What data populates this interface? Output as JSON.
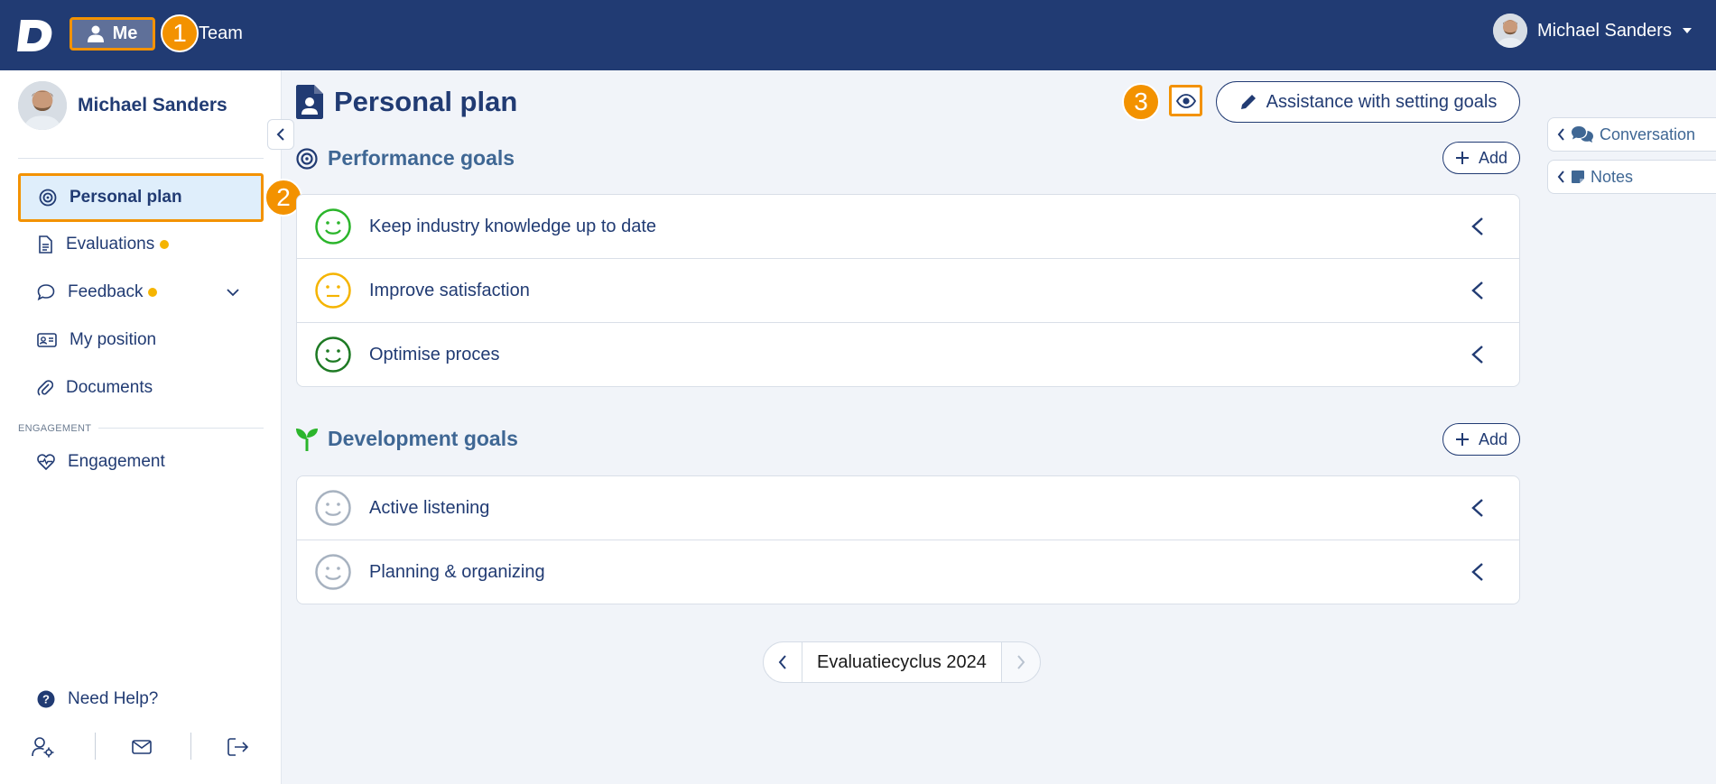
{
  "topbar": {
    "nav": {
      "me_label": "Me",
      "team_label": "Team"
    },
    "user_name": "Michael Sanders"
  },
  "badges": {
    "one": "1",
    "two": "2",
    "three": "3"
  },
  "sidebar": {
    "profile_name": "Michael Sanders",
    "items": [
      {
        "label": "Personal plan",
        "icon": "target-icon",
        "active": true
      },
      {
        "label": "Evaluations",
        "icon": "document-icon",
        "dot": true
      },
      {
        "label": "Feedback",
        "icon": "speech-bubble-icon",
        "dot": true,
        "expandable": true
      },
      {
        "label": "My position",
        "icon": "id-card-icon"
      },
      {
        "label": "Documents",
        "icon": "paperclip-icon"
      }
    ],
    "engagement_section_label": "ENGAGEMENT",
    "engagement_item": {
      "label": "Engagement",
      "icon": "heart-pulse-icon"
    },
    "help_label": "Need Help?"
  },
  "main": {
    "title": "Personal plan",
    "assist_button_label": "Assistance with setting goals",
    "performance": {
      "title": "Performance goals",
      "add_label": "Add",
      "goals": [
        {
          "label": "Keep industry knowledge up to date",
          "mood": "happy",
          "color": "#2bb52b"
        },
        {
          "label": "Improve satisfaction",
          "mood": "neutral",
          "color": "#f5b400"
        },
        {
          "label": "Optimise proces",
          "mood": "happy",
          "color": "#1e7a24"
        }
      ]
    },
    "development": {
      "title": "Development goals",
      "add_label": "Add",
      "goals": [
        {
          "label": "Active listening",
          "mood": "happy",
          "color": "#a7b2c0"
        },
        {
          "label": "Planning & organizing",
          "mood": "happy",
          "color": "#a7b2c0"
        }
      ]
    },
    "cycle_label": "Evaluatiecyclus 2024"
  },
  "right_tabs": {
    "conversation_label": "Conversation",
    "notes_label": "Notes"
  },
  "colors": {
    "topbar": "#213b73",
    "accent": "#f39200",
    "active_nav_bg": "#dfeefb",
    "text": "#213b73"
  }
}
